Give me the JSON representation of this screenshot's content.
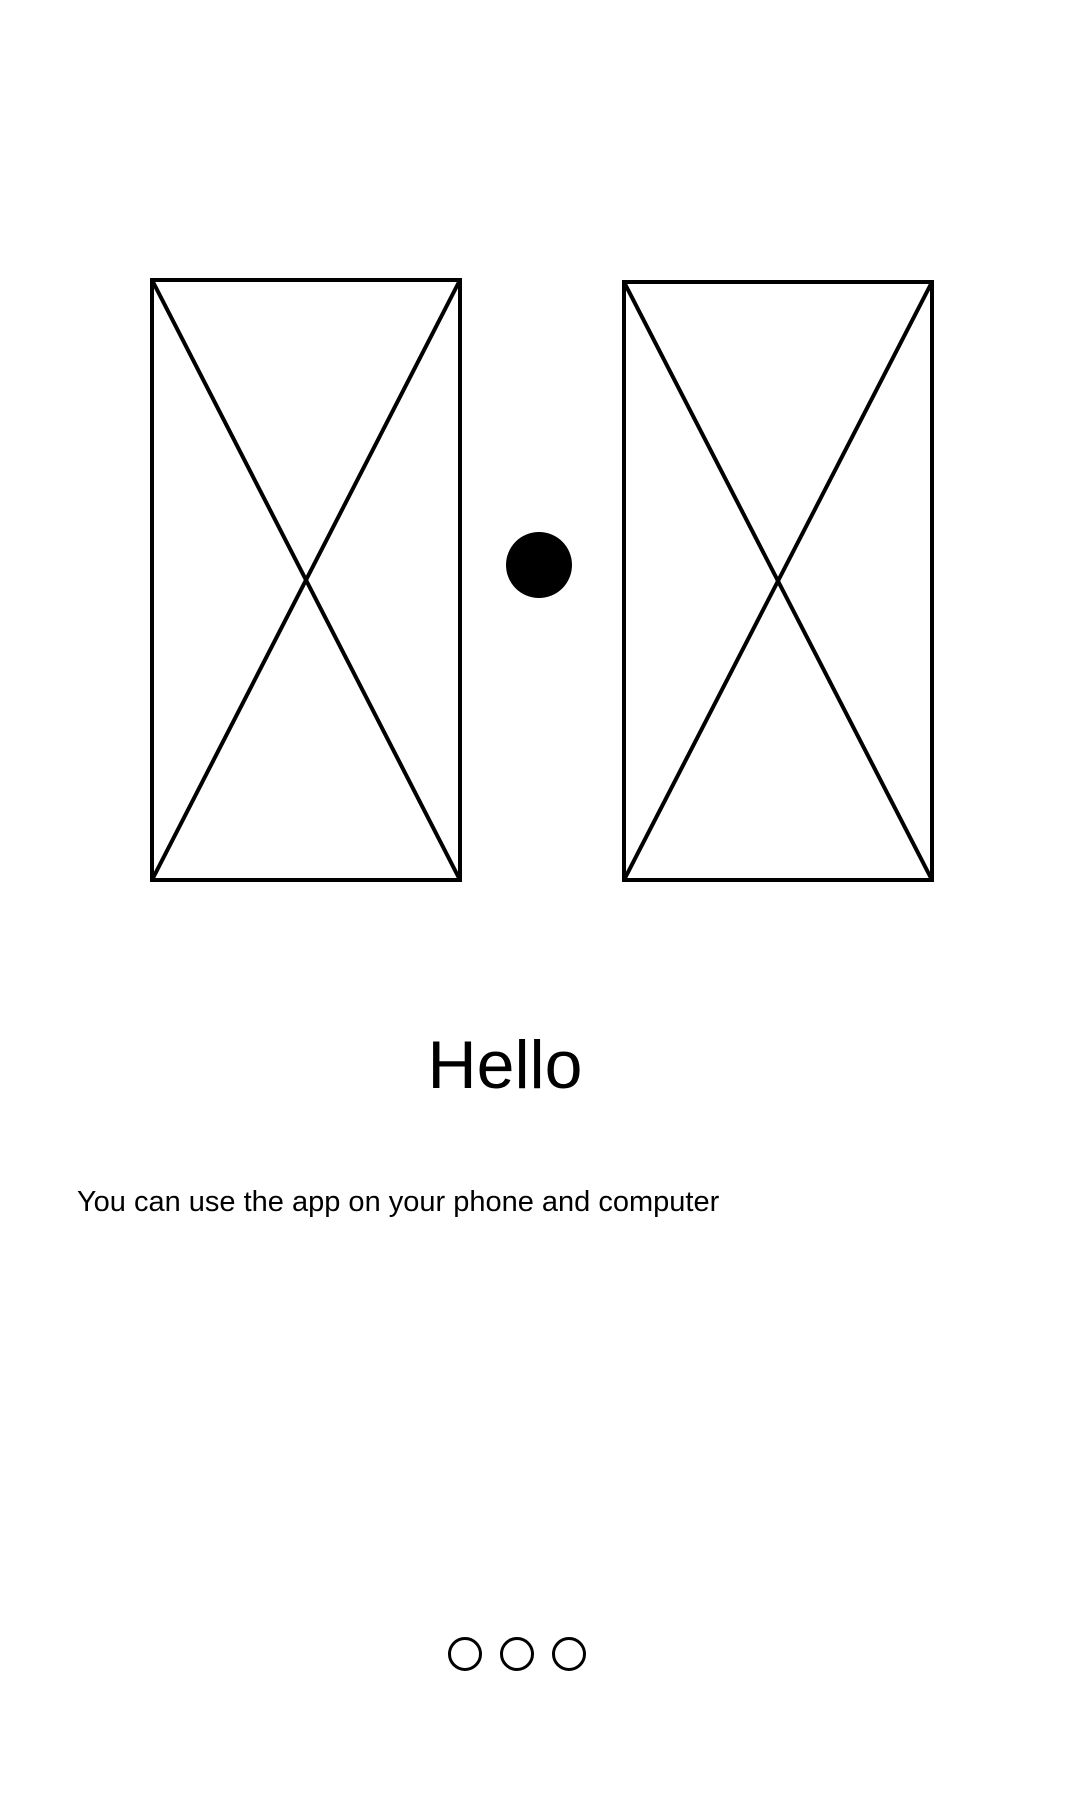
{
  "onboarding": {
    "title": "Hello",
    "subtitle": "You can use the app on your phone and computer",
    "image_placeholders": [
      "phone-image-placeholder",
      "computer-image-placeholder"
    ],
    "pager": {
      "page_count": 3
    }
  },
  "colors": {
    "foreground": "#000000",
    "background": "#ffffff"
  }
}
